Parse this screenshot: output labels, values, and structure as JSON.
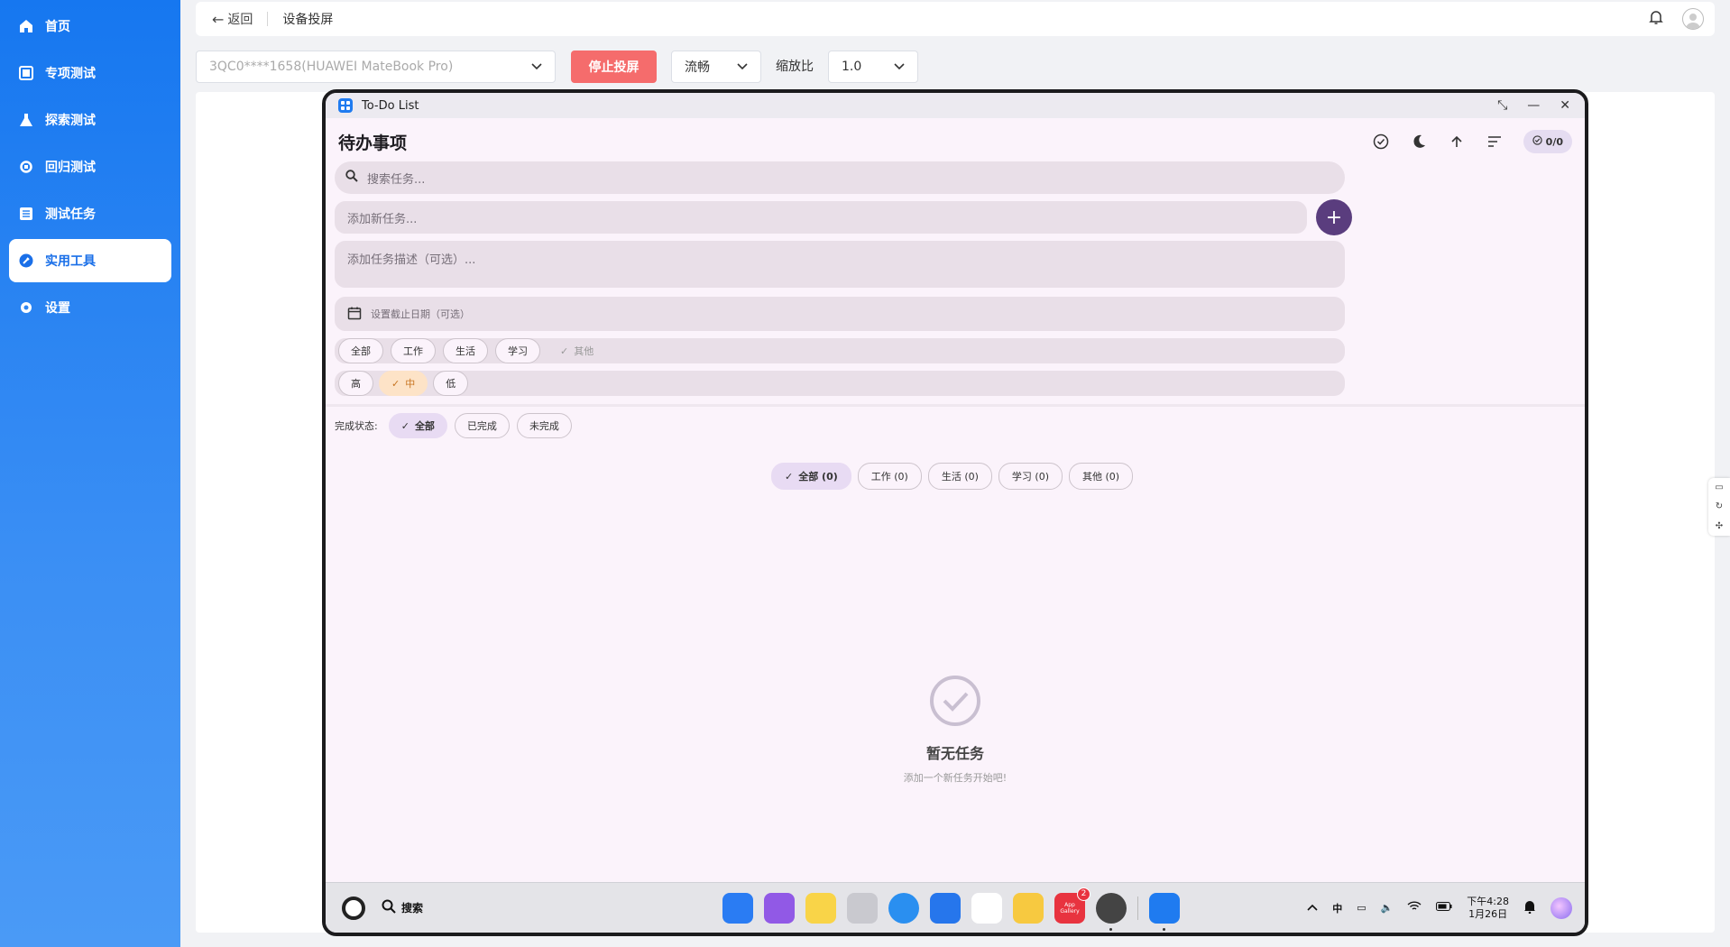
{
  "sidebar": {
    "items": [
      {
        "label": "首页",
        "icon": "home-icon",
        "active": false
      },
      {
        "label": "专项测试",
        "icon": "square-icon",
        "active": false
      },
      {
        "label": "探索测试",
        "icon": "flask-icon",
        "active": false
      },
      {
        "label": "回归测试",
        "icon": "refresh-icon",
        "active": false
      },
      {
        "label": "测试任务",
        "icon": "list-icon",
        "active": false
      },
      {
        "label": "实用工具",
        "icon": "wrench-icon",
        "active": true
      },
      {
        "label": "设置",
        "icon": "gear-icon",
        "active": false
      }
    ]
  },
  "topbar": {
    "back_label": "返回",
    "page_title": "设备投屏"
  },
  "controls": {
    "device_select": "3QC0****1658(HUAWEI MateBook Pro)",
    "stop_button": "停止投屏",
    "quality_select": "流畅",
    "scale_label": "缩放比",
    "scale_select": "1.0"
  },
  "device": {
    "window_title": "To-Do List",
    "app_title": "待办事项",
    "count_badge": "0/0",
    "search_placeholder": "搜索任务...",
    "new_task_placeholder": "添加新任务...",
    "desc_placeholder": "添加任务描述（可选）...",
    "due_date_placeholder": "设置截止日期（可选）",
    "category_chips": [
      "全部",
      "工作",
      "生活",
      "学习",
      "其他"
    ],
    "priority_chips": [
      "高",
      "中",
      "低"
    ],
    "status_label": "完成状态:",
    "status_chips": [
      "全部",
      "已完成",
      "未完成"
    ],
    "filter_tabs": [
      "全部 (0)",
      "工作 (0)",
      "生活 (0)",
      "学习 (0)",
      "其他 (0)"
    ],
    "empty_title": "暂无任务",
    "empty_sub": "添加一个新任务开始吧!",
    "taskbar": {
      "search_label": "搜索",
      "appgallery_badge": "2",
      "appgallery_label": "App Gallery",
      "ime": "中",
      "time": "下午4:28",
      "date": "1月26日"
    }
  },
  "colors": {
    "sidebar": "#1677f0",
    "stop_button": "#f56c6c",
    "add_button": "#5a3d7e",
    "device_bg": "#fbf3fb"
  }
}
